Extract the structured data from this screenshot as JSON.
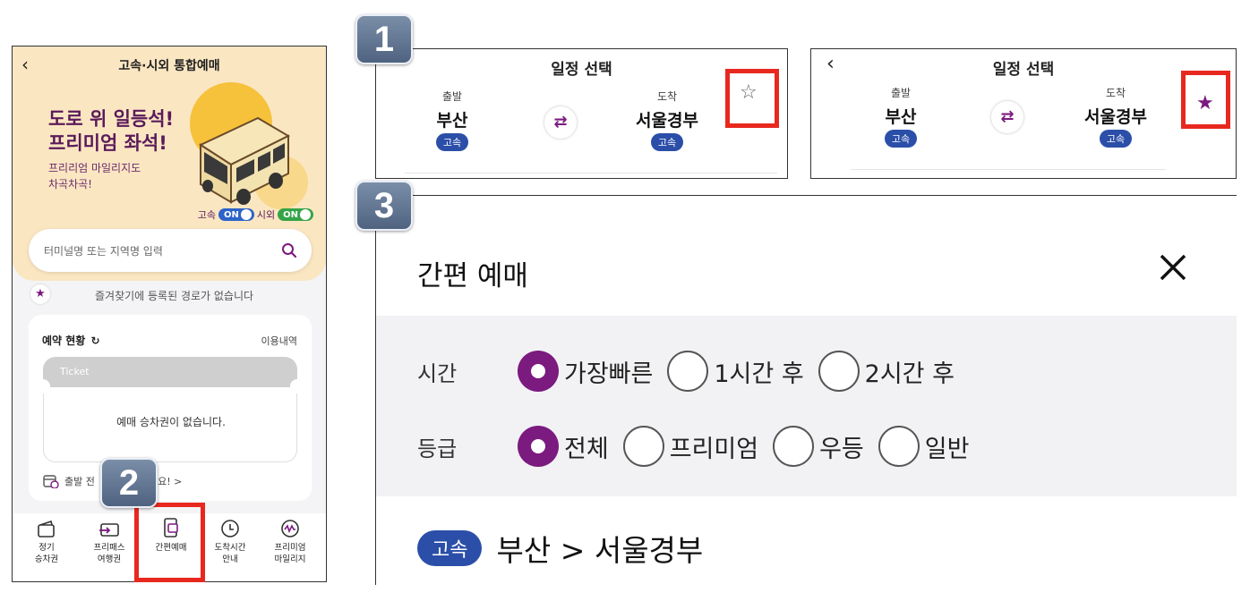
{
  "phone": {
    "back_glyph": "‹",
    "title": "고속·시외 통합예매",
    "hero_title_line1": "도로 위 일등석!",
    "hero_title_line2": "프리미엄 좌석!",
    "hero_sub_line1": "프리리엄 마일리지도",
    "hero_sub_line2": "차곡차곡!",
    "toggle_express_label": "고속",
    "toggle_express_state": "ON",
    "toggle_intercity_label": "시외",
    "toggle_intercity_state": "ON",
    "search_placeholder": "터미널명 또는 지역명 입력",
    "favorites_empty": "즐겨찾기에 등록된 경로가 없습니다",
    "reservation_title": "예약 현황",
    "reservation_history": "이용내역",
    "ticket_label": "Ticket",
    "ticket_empty": "예매 승차권이 없습니다.",
    "depart_text_left": "출발 전",
    "depart_text_right": "보세요! >",
    "nav": [
      {
        "label": "정기\n승차권",
        "icon": "season-ticket-icon"
      },
      {
        "label": "프리패스\n여행권",
        "icon": "free-pass-icon"
      },
      {
        "label": "간편예매",
        "icon": "quick-booking-icon"
      },
      {
        "label": "도착시간\n안내",
        "icon": "clock-icon"
      },
      {
        "label": "프리미엄\n마일리지",
        "icon": "mileage-icon"
      }
    ],
    "colors": {
      "hero_bg": "#fbe6c2",
      "brand_purple": "#7b1a7f",
      "highlight_red": "#e8281e"
    }
  },
  "badges": {
    "one": "1",
    "two": "2",
    "three": "3"
  },
  "schedule": {
    "title": "일정 선택",
    "back_glyph": "‹",
    "depart_caption": "출발",
    "depart_name": "부산",
    "arrive_caption": "도착",
    "arrive_name": "서울경부",
    "bus_type": "고속",
    "swap_glyph": "⇄",
    "star_empty": "☆",
    "star_filled": "★"
  },
  "quick": {
    "title": "간편 예매",
    "time_label": "시간",
    "time_options": [
      {
        "label": "가장빠른",
        "selected": true
      },
      {
        "label": "1시간 후",
        "selected": false
      },
      {
        "label": "2시간 후",
        "selected": false
      }
    ],
    "grade_label": "등급",
    "grade_options": [
      {
        "label": "전체",
        "selected": true
      },
      {
        "label": "프리미엄",
        "selected": false
      },
      {
        "label": "우등",
        "selected": false
      },
      {
        "label": "일반",
        "selected": false
      }
    ],
    "route_type": "고속",
    "route_text": "부산 > 서울경부"
  }
}
